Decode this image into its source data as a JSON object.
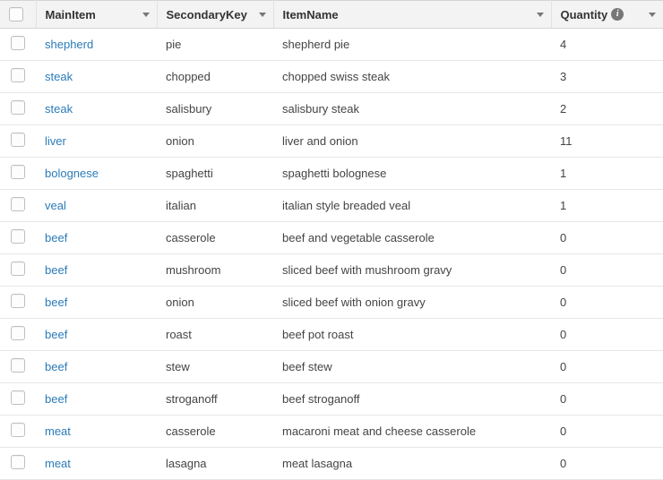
{
  "headers": {
    "mainItem": "MainItem",
    "secondaryKey": "SecondaryKey",
    "itemName": "ItemName",
    "quantity": "Quantity"
  },
  "rows": [
    {
      "mainItem": "shepherd",
      "secondaryKey": "pie",
      "itemName": "shepherd pie",
      "quantity": 4
    },
    {
      "mainItem": "steak",
      "secondaryKey": "chopped",
      "itemName": "chopped swiss steak",
      "quantity": 3
    },
    {
      "mainItem": "steak",
      "secondaryKey": "salisbury",
      "itemName": "salisbury steak",
      "quantity": 2
    },
    {
      "mainItem": "liver",
      "secondaryKey": "onion",
      "itemName": "liver and onion",
      "quantity": 11
    },
    {
      "mainItem": "bolognese",
      "secondaryKey": "spaghetti",
      "itemName": "spaghetti bolognese",
      "quantity": 1
    },
    {
      "mainItem": "veal",
      "secondaryKey": "italian",
      "itemName": "italian style breaded veal",
      "quantity": 1
    },
    {
      "mainItem": "beef",
      "secondaryKey": "casserole",
      "itemName": "beef and vegetable casserole",
      "quantity": 0
    },
    {
      "mainItem": "beef",
      "secondaryKey": "mushroom",
      "itemName": "sliced beef with mushroom gravy",
      "quantity": 0
    },
    {
      "mainItem": "beef",
      "secondaryKey": "onion",
      "itemName": "sliced beef with onion gravy",
      "quantity": 0
    },
    {
      "mainItem": "beef",
      "secondaryKey": "roast",
      "itemName": "beef pot roast",
      "quantity": 0
    },
    {
      "mainItem": "beef",
      "secondaryKey": "stew",
      "itemName": "beef stew",
      "quantity": 0
    },
    {
      "mainItem": "beef",
      "secondaryKey": "stroganoff",
      "itemName": "beef stroganoff",
      "quantity": 0
    },
    {
      "mainItem": "meat",
      "secondaryKey": "casserole",
      "itemName": "macaroni meat and cheese casserole",
      "quantity": 0
    },
    {
      "mainItem": "meat",
      "secondaryKey": "lasagna",
      "itemName": "meat lasagna",
      "quantity": 0
    }
  ]
}
